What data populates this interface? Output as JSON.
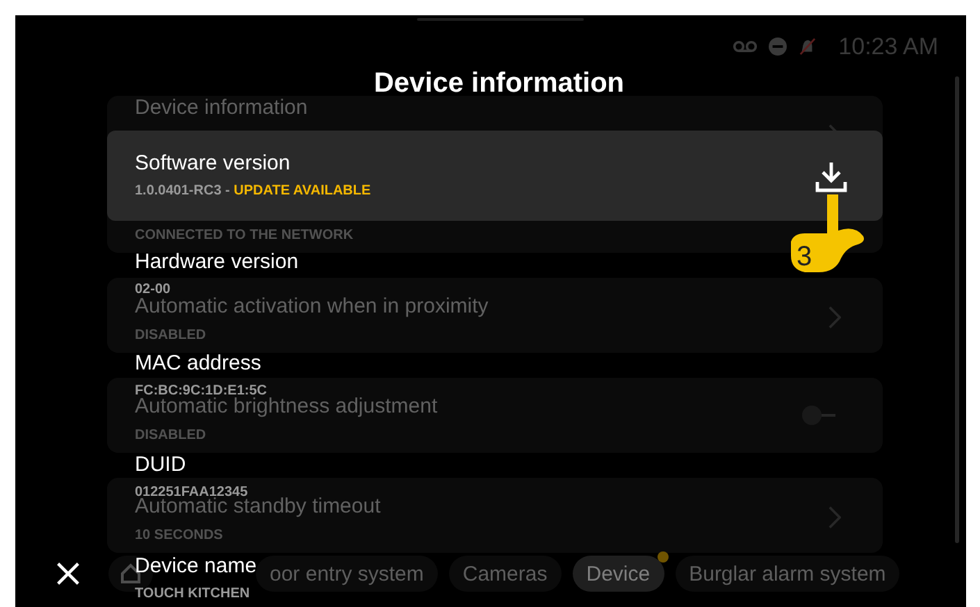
{
  "status_bar": {
    "time": "10:23 AM"
  },
  "background_list": [
    {
      "title": "Device information",
      "kind": "chevron"
    },
    {
      "subtitle": "CONNECTED TO THE NETWORK",
      "kind": "plain"
    },
    {
      "title": "Automatic activation when in proximity",
      "subtitle": "DISABLED",
      "kind": "chevron"
    },
    {
      "title": "Automatic brightness adjustment",
      "subtitle": "DISABLED",
      "kind": "toggle",
      "on": false
    },
    {
      "title": "Automatic standby timeout",
      "subtitle": "10 SECONDS",
      "kind": "chevron"
    }
  ],
  "bottom_tabs": [
    {
      "kind": "home",
      "selected": false
    },
    {
      "kind": "text",
      "label": "oor entry system",
      "selected": false
    },
    {
      "kind": "text",
      "label": "Cameras",
      "selected": false
    },
    {
      "kind": "text",
      "label": "Device",
      "selected": true,
      "badge": true
    },
    {
      "kind": "text",
      "label": "Burglar alarm system",
      "selected": false
    }
  ],
  "dialog": {
    "title": "Device information",
    "software": {
      "label": "Software version",
      "value": "1.0.0401-RC3 - ",
      "status": "UPDATE AVAILABLE"
    },
    "rows": [
      {
        "label": "Hardware version",
        "value": "02-00"
      },
      {
        "label": "MAC address",
        "value": "FC:BC:9C:1D:E1:5C"
      },
      {
        "label": "DUID",
        "value": "012251FAA12345"
      },
      {
        "label": "Device name",
        "value": "TOUCH KITCHEN"
      }
    ],
    "tutorial_step": "3"
  }
}
